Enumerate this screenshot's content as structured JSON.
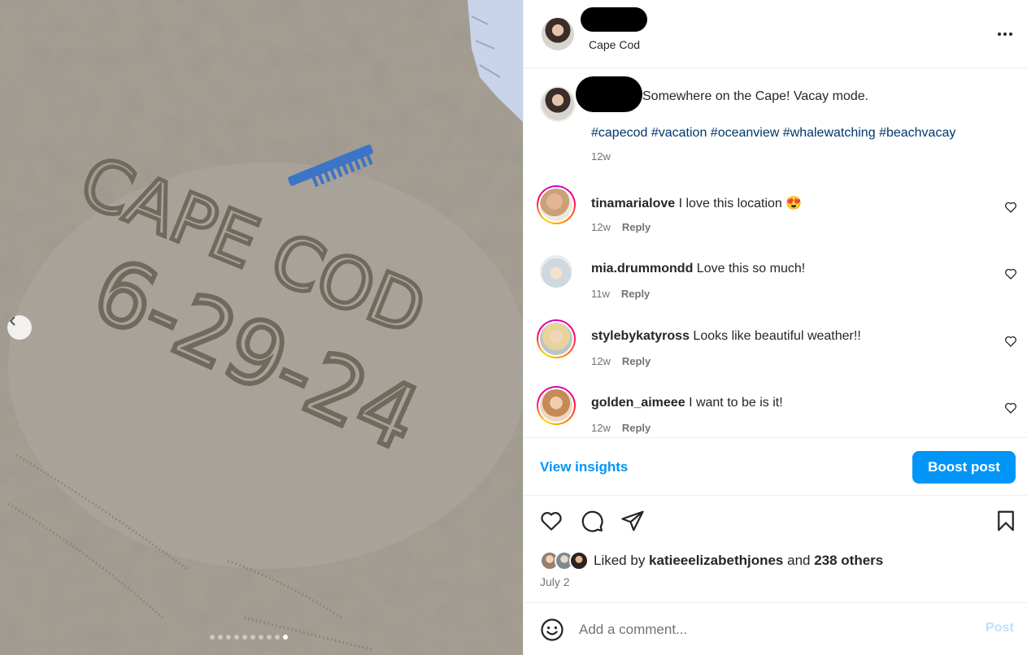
{
  "post": {
    "location": "Cape Cod",
    "caption": "Somewhere on the Cape! Vacay mode.",
    "hashtags": [
      "#capecod",
      "#vacation",
      "#oceanview",
      "#whalewatching",
      "#beachvacay"
    ],
    "caption_time": "12w",
    "more_icon": "more-horizontal-icon"
  },
  "photo": {
    "sand_text_line1": "CAPE COD",
    "sand_text_line2": "6-29-24",
    "slide_count": 10,
    "active_slide": 10
  },
  "comments": [
    {
      "username": "tinamarialove",
      "text": "I love this location 😍",
      "time": "12w",
      "reply_label": "Reply",
      "story_ring": true
    },
    {
      "username": "mia.drummondd",
      "text": "Love this so much!",
      "time": "11w",
      "reply_label": "Reply",
      "story_ring": false
    },
    {
      "username": "stylebykatyross",
      "text": "Looks like beautiful weather!!",
      "time": "12w",
      "reply_label": "Reply",
      "story_ring": true
    },
    {
      "username": "golden_aimeee",
      "text": "I want to be is it!",
      "time": "12w",
      "reply_label": "Reply",
      "story_ring": true
    }
  ],
  "insights": {
    "view_label": "View insights",
    "boost_label": "Boost post"
  },
  "likes": {
    "prefix": "Liked by ",
    "user": "katieeelizabethjones",
    "middle": " and ",
    "others": "238 others"
  },
  "post_date": "July 2",
  "comment_box": {
    "placeholder": "Add a comment...",
    "post_label": "Post"
  },
  "colors": {
    "accent_blue": "#0095f6",
    "hashtag_blue": "#00376b",
    "secondary_text": "#737373"
  }
}
